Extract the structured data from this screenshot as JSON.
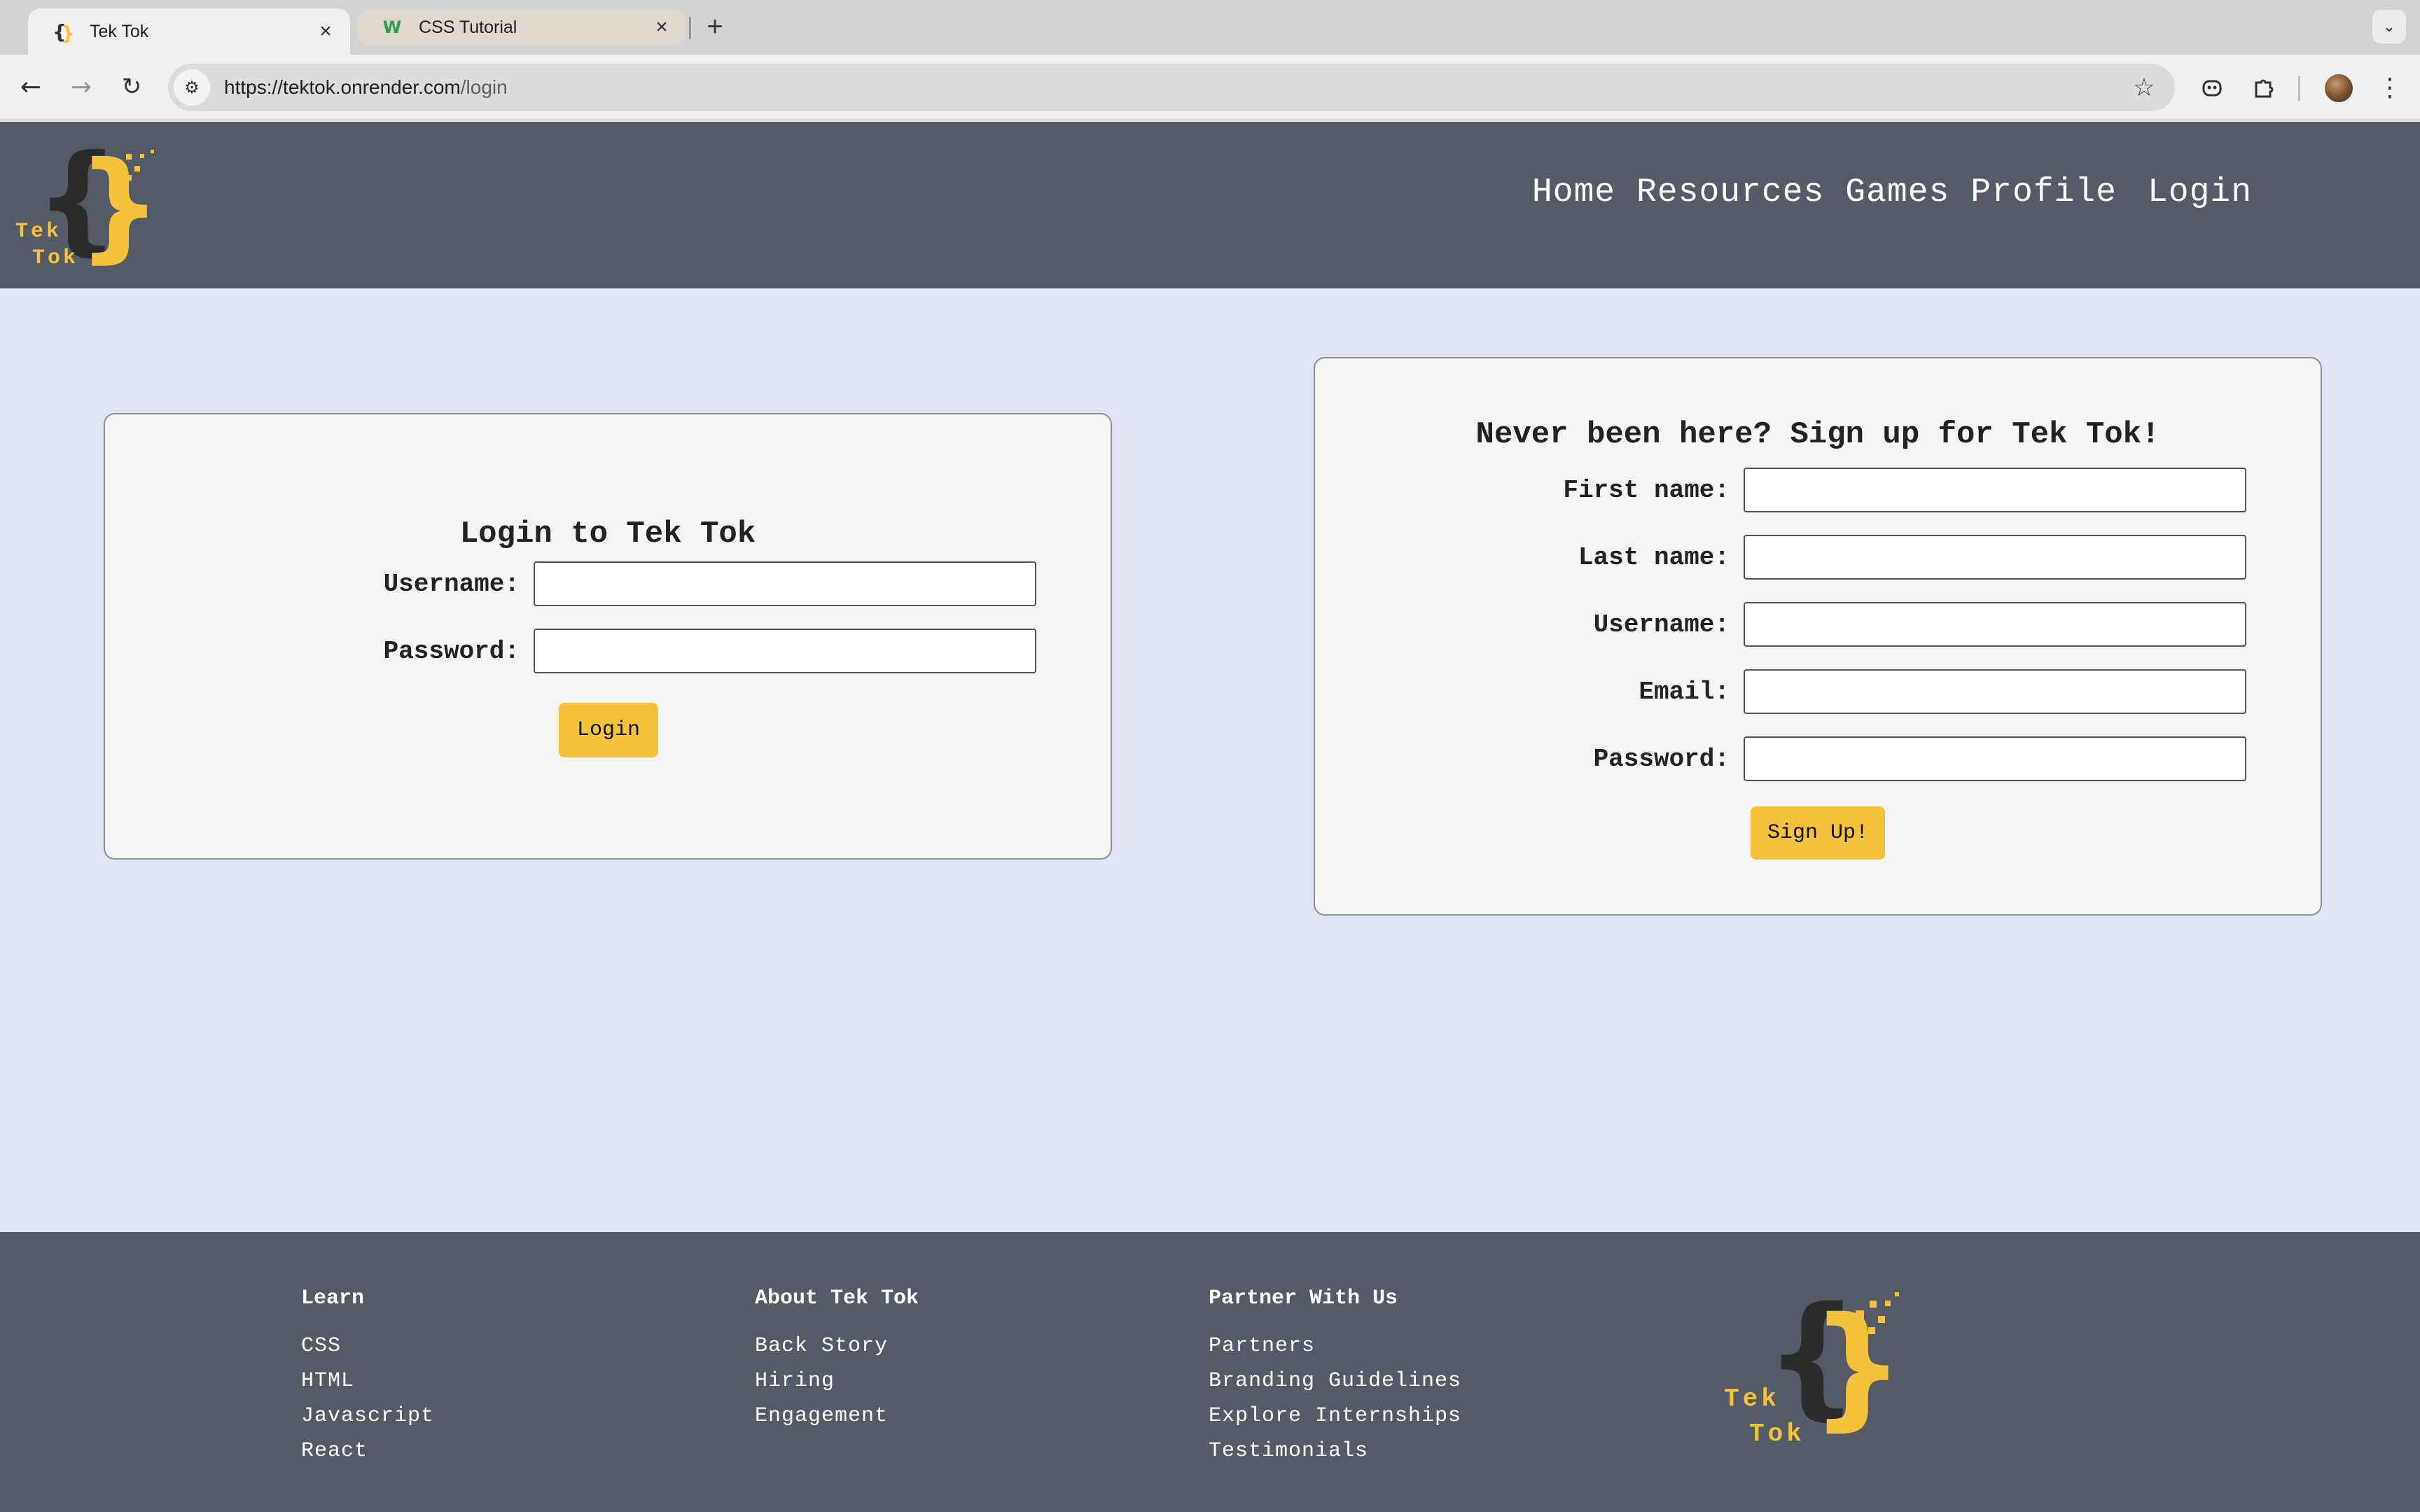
{
  "browser": {
    "tabs": [
      {
        "title": "Tek Tok",
        "favicon": "tektok-favicon-icon",
        "active": true
      },
      {
        "title": "CSS Tutorial",
        "favicon": "w3schools-favicon-icon",
        "active": false
      }
    ],
    "url": {
      "host": "https://tektok.onrender.com",
      "path": "/login"
    }
  },
  "header": {
    "logo_text_1": "Tek",
    "logo_text_2": "Tok",
    "nav": [
      "Home",
      "Resources",
      "Games",
      "Profile",
      "Login"
    ]
  },
  "login": {
    "title": "Login to Tek Tok",
    "username_label": "Username:",
    "password_label": "Password:",
    "button": "Login"
  },
  "signup": {
    "title": "Never been here? Sign up for Tek Tok!",
    "first_name_label": "First name:",
    "last_name_label": "Last name:",
    "username_label": "Username:",
    "email_label": "Email:",
    "password_label": "Password:",
    "button": "Sign Up!"
  },
  "footer": {
    "learn": {
      "heading": "Learn",
      "links": [
        "CSS",
        "HTML",
        "Javascript",
        "React"
      ]
    },
    "about": {
      "heading": "About Tek Tok",
      "links": [
        "Back Story",
        "Hiring",
        "Engagement"
      ]
    },
    "partner": {
      "heading": "Partner With Us",
      "links": [
        "Partners",
        "Branding Guidelines",
        "Explore Internships",
        "Testimonials"
      ]
    },
    "logo_text_1": "Tek",
    "logo_text_2": "Tok"
  },
  "colors": {
    "header_bg": "#545b67",
    "page_bg": "#dfe5f3",
    "accent_yellow": "#f5c33b",
    "card_bg": "#f4f4f4"
  }
}
